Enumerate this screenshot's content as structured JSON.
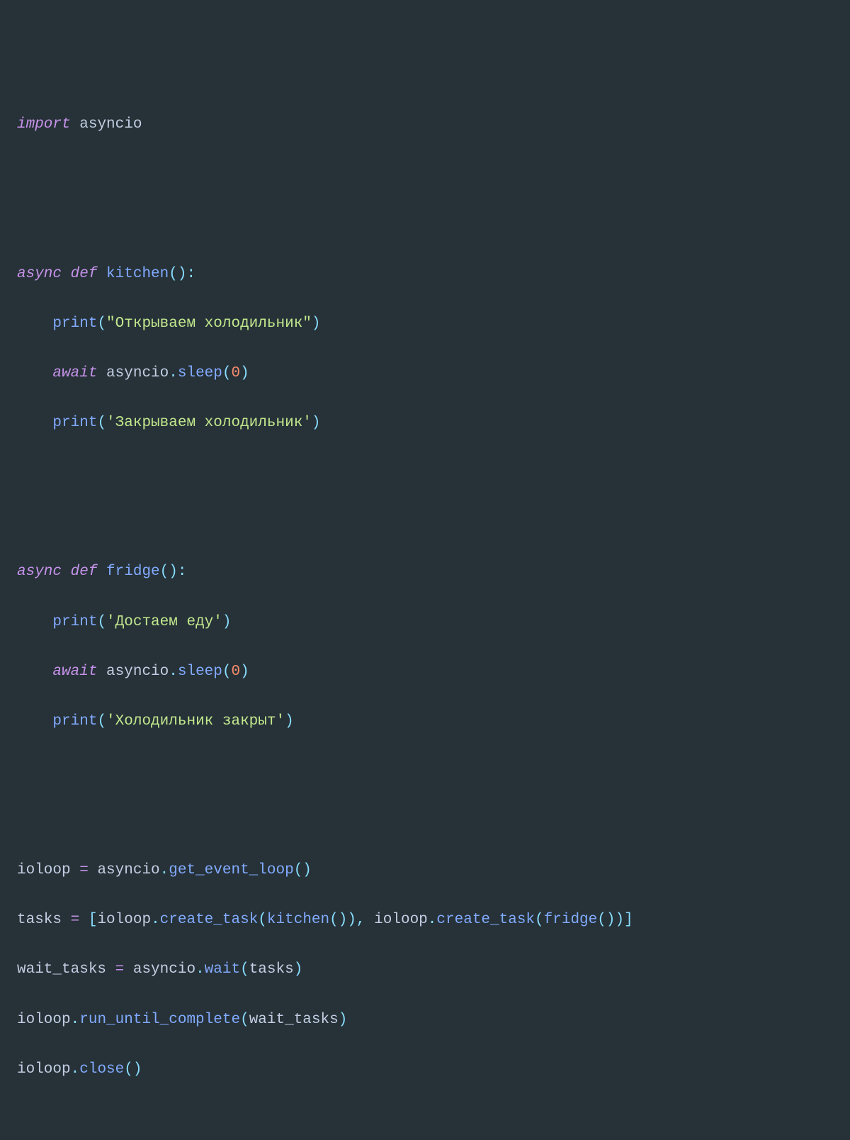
{
  "code": {
    "line1": {
      "import": "import",
      "sp": " ",
      "asyncio": "asyncio"
    },
    "line2": "",
    "line3": "",
    "line4": {
      "async": "async",
      "def": "def",
      "name": "kitchen",
      "parens": "():",
      "sp": " "
    },
    "line5": {
      "print": "print",
      "lp": "(",
      "str": "\"Открываем холодильник\"",
      "rp": ")"
    },
    "line6": {
      "await": "await",
      "asyncio": "asyncio",
      "dot": ".",
      "sleep": "sleep",
      "lp": "(",
      "num": "0",
      "rp": ")",
      "sp": " "
    },
    "line7": {
      "print": "print",
      "lp": "(",
      "str": "'Закрываем холодильник'",
      "rp": ")"
    },
    "line8": "",
    "line9": "",
    "line10": {
      "async": "async",
      "def": "def",
      "name": "fridge",
      "parens": "():",
      "sp": " "
    },
    "line11": {
      "print": "print",
      "lp": "(",
      "str": "'Достаем еду'",
      "rp": ")"
    },
    "line12": {
      "await": "await",
      "asyncio": "asyncio",
      "dot": ".",
      "sleep": "sleep",
      "lp": "(",
      "num": "0",
      "rp": ")",
      "sp": " "
    },
    "line13": {
      "print": "print",
      "lp": "(",
      "str": "'Холодильник закрыт'",
      "rp": ")"
    },
    "line14": "",
    "line15": "",
    "line16": {
      "ioloop": "ioloop",
      "eq": " = ",
      "asyncio": "asyncio",
      "dot": ".",
      "gel": "get_event_loop",
      "parens": "()"
    },
    "line17": {
      "tasks": "tasks",
      "eq": " = ",
      "lb": "[",
      "ioloop1": "ioloop",
      "dot1": ".",
      "ct1": "create_task",
      "lp1": "(",
      "kitchen": "kitchen",
      "kp": "()",
      "rp1": ")",
      "comma": ", ",
      "ioloop2": "ioloop",
      "dot2": ".",
      "ct2": "create_task",
      "lp2": "(",
      "fridge": "fridge",
      "fp": "()",
      "rp2": ")",
      "rb": "]"
    },
    "line18": {
      "wt": "wait_tasks",
      "eq": " = ",
      "asyncio": "asyncio",
      "dot": ".",
      "wait": "wait",
      "lp": "(",
      "tasks": "tasks",
      "rp": ")"
    },
    "line19": {
      "ioloop": "ioloop",
      "dot": ".",
      "ruc": "run_until_complete",
      "lp": "(",
      "wt": "wait_tasks",
      "rp": ")"
    },
    "line20": {
      "ioloop": "ioloop",
      "dot": ".",
      "close": "close",
      "parens": "()"
    }
  }
}
